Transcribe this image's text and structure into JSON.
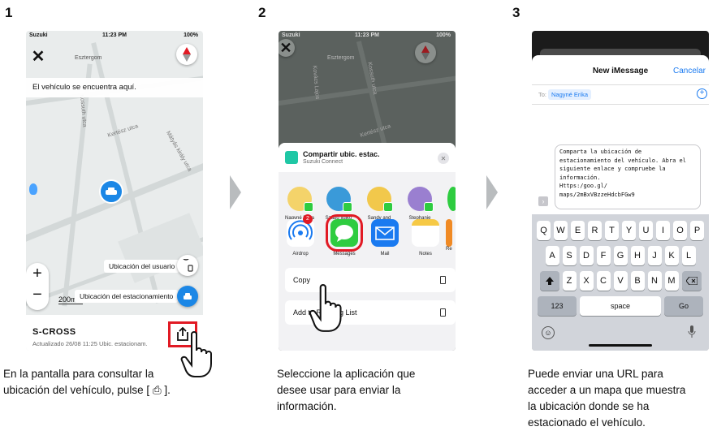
{
  "steps": [
    {
      "number": "1",
      "caption_lines": [
        "En la pantalla para consultar la",
        "ubicación del vehículo, pulse [ ⎙ ]."
      ],
      "status": {
        "carrier": "Suzuki",
        "time": "11:23 PM",
        "battery": "100%"
      },
      "map": {
        "place_esztergom": "Esztergom",
        "street_1": "Kertész utca",
        "street_2": "Mátyás király utca",
        "street_3": "Kossuth utca",
        "street_4": "Kovács Lajos",
        "street_5": "Vadvirág utca",
        "vehicle_tooltip": "El vehículo se encuentra aquí.",
        "user_location_label": "Ubicación del usuario",
        "parking_location_label": "Ubicación del estacionamiento",
        "zoom_in": "+",
        "zoom_out": "−",
        "scale": "200m"
      },
      "bottom_card": {
        "title": "S-CROSS",
        "subtitle": "Actualizado 26/08 11:25 Ubic. estacionam."
      }
    },
    {
      "number": "2",
      "caption_lines": [
        "Seleccione la aplicación que",
        "desee usar para enviar la",
        "información."
      ],
      "status": {
        "carrier": "Suzuki",
        "time": "11:23 PM",
        "battery": "100%"
      },
      "share": {
        "title": "Compartir ubic. estac.",
        "subtitle": "Suzuki Connect",
        "people": [
          "Nagyné Erika",
          "Szabó Ildikó",
          "Sandy and",
          "Stephanie"
        ],
        "apps": [
          "Airdrop",
          "Messages",
          "Mail",
          "Notes",
          "Re"
        ],
        "airdrop_badge": "2",
        "actions": [
          "Copy",
          "Add to Reading List"
        ]
      },
      "map": {
        "place_esztergom": "Esztergom",
        "street_1": "Kertész utca",
        "street_3": "Kossuth utca",
        "street_4": "Kovács Lajos"
      }
    },
    {
      "number": "3",
      "caption_lines": [
        "Puede enviar una URL para",
        "acceder a un mapa que muestra",
        "la ubicación donde se ha",
        "estacionado el vehículo."
      ],
      "message": {
        "header_title": "New iMessage",
        "cancel": "Cancelar",
        "to_label": "To:",
        "recipient": "Nagyné Erika",
        "body_lines": [
          "Comparta la ubicación de",
          "estacionamiento del vehículo. Abra el",
          "siguiente enlace y compruebe la",
          "información.",
          "Https:/goo.gl/",
          "maps/2mBxVBzzeHdcbFGw9"
        ]
      },
      "keyboard": {
        "row1": [
          "Q",
          "W",
          "E",
          "R",
          "T",
          "Y",
          "U",
          "I",
          "O",
          "P"
        ],
        "row2": [
          "A",
          "S",
          "D",
          "F",
          "G",
          "H",
          "J",
          "K",
          "L"
        ],
        "row3": [
          "Z",
          "X",
          "C",
          "V",
          "B",
          "N",
          "M"
        ],
        "numbers": "123",
        "space": "space",
        "go": "Go"
      }
    }
  ],
  "colors": {
    "accent_red": "#e11a24",
    "ios_blue": "#1a7af0",
    "pin_blue": "#1b87e6",
    "teal": "#1fc7a5",
    "arrow_gray": "#b9bcbe"
  }
}
